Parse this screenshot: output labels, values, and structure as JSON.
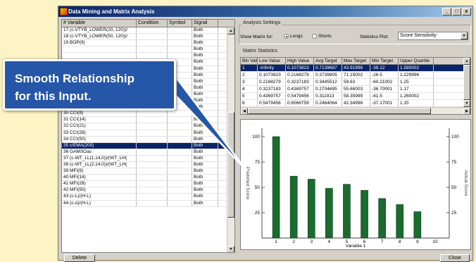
{
  "window": {
    "title": "Data Mining and Matrix Analysis",
    "btn_min": "_",
    "btn_max": "□",
    "btn_close": "x"
  },
  "var_grid": {
    "headers": [
      "#  Variable",
      "Condition",
      "Symbol",
      "Signal"
    ],
    "rows": [
      {
        "var": "17 (c-VTYB_LOWER(20, 120))/",
        "cond": "",
        "sym": "",
        "sig": "Both"
      },
      {
        "var": "18 (c-VTYB_LOWER(50, 120))/",
        "cond": "",
        "sym": "",
        "sig": "Both"
      },
      {
        "var": "19 BOP(9)",
        "cond": "",
        "sym": "",
        "sig": "Both"
      },
      {
        "var": "",
        "cond": "",
        "sym": "",
        "sig": "Both"
      },
      {
        "var": "",
        "cond": "",
        "sym": "",
        "sig": "Both"
      },
      {
        "var": "",
        "cond": "",
        "sym": "",
        "sig": "Both"
      },
      {
        "var": "",
        "cond": "",
        "sym": "",
        "sig": "Both"
      },
      {
        "var": "",
        "cond": "",
        "sym": "",
        "sig": "Both"
      },
      {
        "var": "",
        "cond": "",
        "sym": "",
        "sig": "Both"
      },
      {
        "var": "",
        "cond": "",
        "sym": "",
        "sig": "Both"
      },
      {
        "var": "",
        "cond": "",
        "sym": "",
        "sig": "Both"
      },
      {
        "var": "28 RSI(50)",
        "cond": "",
        "sym": "",
        "sig": "Both"
      },
      {
        "var": "29 CCI(6)",
        "cond": "",
        "sym": "",
        "sig": "Both"
      },
      {
        "var": "30 CCI(9)",
        "cond": "",
        "sym": "",
        "sig": "Both"
      },
      {
        "var": "31 CCI(14)",
        "cond": "",
        "sym": "",
        "sig": "Both"
      },
      {
        "var": "32 CCI(21)",
        "cond": "",
        "sym": "",
        "sig": "Both"
      },
      {
        "var": "33 CCI(28)",
        "cond": "",
        "sym": "",
        "sig": "Both"
      },
      {
        "var": "34 CCI(50)",
        "cond": "",
        "sym": "",
        "sig": "Both"
      },
      {
        "var": "35 c/EMA(200)",
        "cond": "",
        "sym": "",
        "sig": "Both",
        "selected": true
      },
      {
        "var": "36 GAMSOac",
        "cond": "",
        "sym": "",
        "sig": "Both"
      },
      {
        "var": "37 (c-WT_LL(1,14,0))/(WT_LH(",
        "cond": "",
        "sym": "",
        "sig": "Both"
      },
      {
        "var": "38 (c-WT_LL(2,14,0))/(WT_LH(",
        "cond": "",
        "sym": "",
        "sig": "Both"
      },
      {
        "var": "39 MFI(9)",
        "cond": "",
        "sym": "",
        "sig": "Both"
      },
      {
        "var": "40 MFI(14)",
        "cond": "",
        "sym": "",
        "sig": "Both"
      },
      {
        "var": "41 MFI(28)",
        "cond": "",
        "sym": "",
        "sig": "Both"
      },
      {
        "var": "42 MFI(50)",
        "cond": "",
        "sym": "",
        "sig": "Both"
      },
      {
        "var": "43 (c-L)/(H-L)",
        "cond": "",
        "sym": "",
        "sig": "Both"
      },
      {
        "var": "44 (c-o)/(H-L)",
        "cond": "",
        "sym": "",
        "sig": "Both"
      }
    ]
  },
  "analysis": {
    "group_label": "Analysis Settings",
    "show_label": "Show Matrix for:",
    "longs_label": "Longs",
    "shorts_label": "Shorts",
    "longs_selected": true,
    "plot_label": "Statistics Plot:",
    "plot_value": "Score Sensitivity"
  },
  "matrix": {
    "group_label": "Matrix Statistics",
    "headers": [
      "Bin Value",
      "Low Value",
      "High Value",
      "Avg Target",
      "Max Target",
      "Min Target",
      "Upper Quartile"
    ],
    "rows": [
      [
        "1",
        "-Infinity",
        "0.1073823",
        "0.7139687",
        "43.91998",
        "-38.12",
        "1.580002"
      ],
      [
        "2",
        "0.1073823",
        "0.2168279",
        "0.3739805",
        "71.15002",
        "-26.5",
        "1.229996"
      ],
      [
        "3",
        "0.2168279",
        "0.3237183",
        "0.3445512",
        "59.63",
        "-60.21002",
        "1.25"
      ],
      [
        "4",
        "0.3237183",
        "0.4369757",
        "0.2704695",
        "55.66003",
        "-36.70001",
        "1.17"
      ],
      [
        "5",
        "0.4369757",
        "0.5479456",
        "0.311913",
        "58.35999",
        "-41.5",
        "1.260002"
      ],
      [
        "6",
        "0.5479456",
        "0.6566759",
        "0.2464064",
        "42.34998",
        "-37.17001",
        "1.15"
      ],
      [
        "7",
        "0.6566759",
        "0.7568631",
        "0.1734709",
        "43.70001",
        "-103.2898",
        "1.139999"
      ]
    ],
    "selected_row": 0
  },
  "chart_data": {
    "type": "bar",
    "categories": [
      "1",
      "2",
      "3",
      "4",
      "5",
      "6",
      "7",
      "8",
      "9",
      "10"
    ],
    "values": [
      100,
      61,
      58,
      49,
      53,
      47,
      39,
      33,
      26,
      0
    ],
    "xlabel": "Variable 1",
    "ylabel": "Predicted Score",
    "ylabel_right": "Actual Score",
    "yticks": [
      "100",
      "75",
      "50",
      "25"
    ],
    "ylim": [
      0,
      100
    ],
    "bar_color": "#1a6b2e",
    "grid": false
  },
  "callout": {
    "line1": "Smooth Relationship",
    "line2": "for this Input."
  },
  "buttons": {
    "delete": "Delete",
    "close": "Close"
  }
}
